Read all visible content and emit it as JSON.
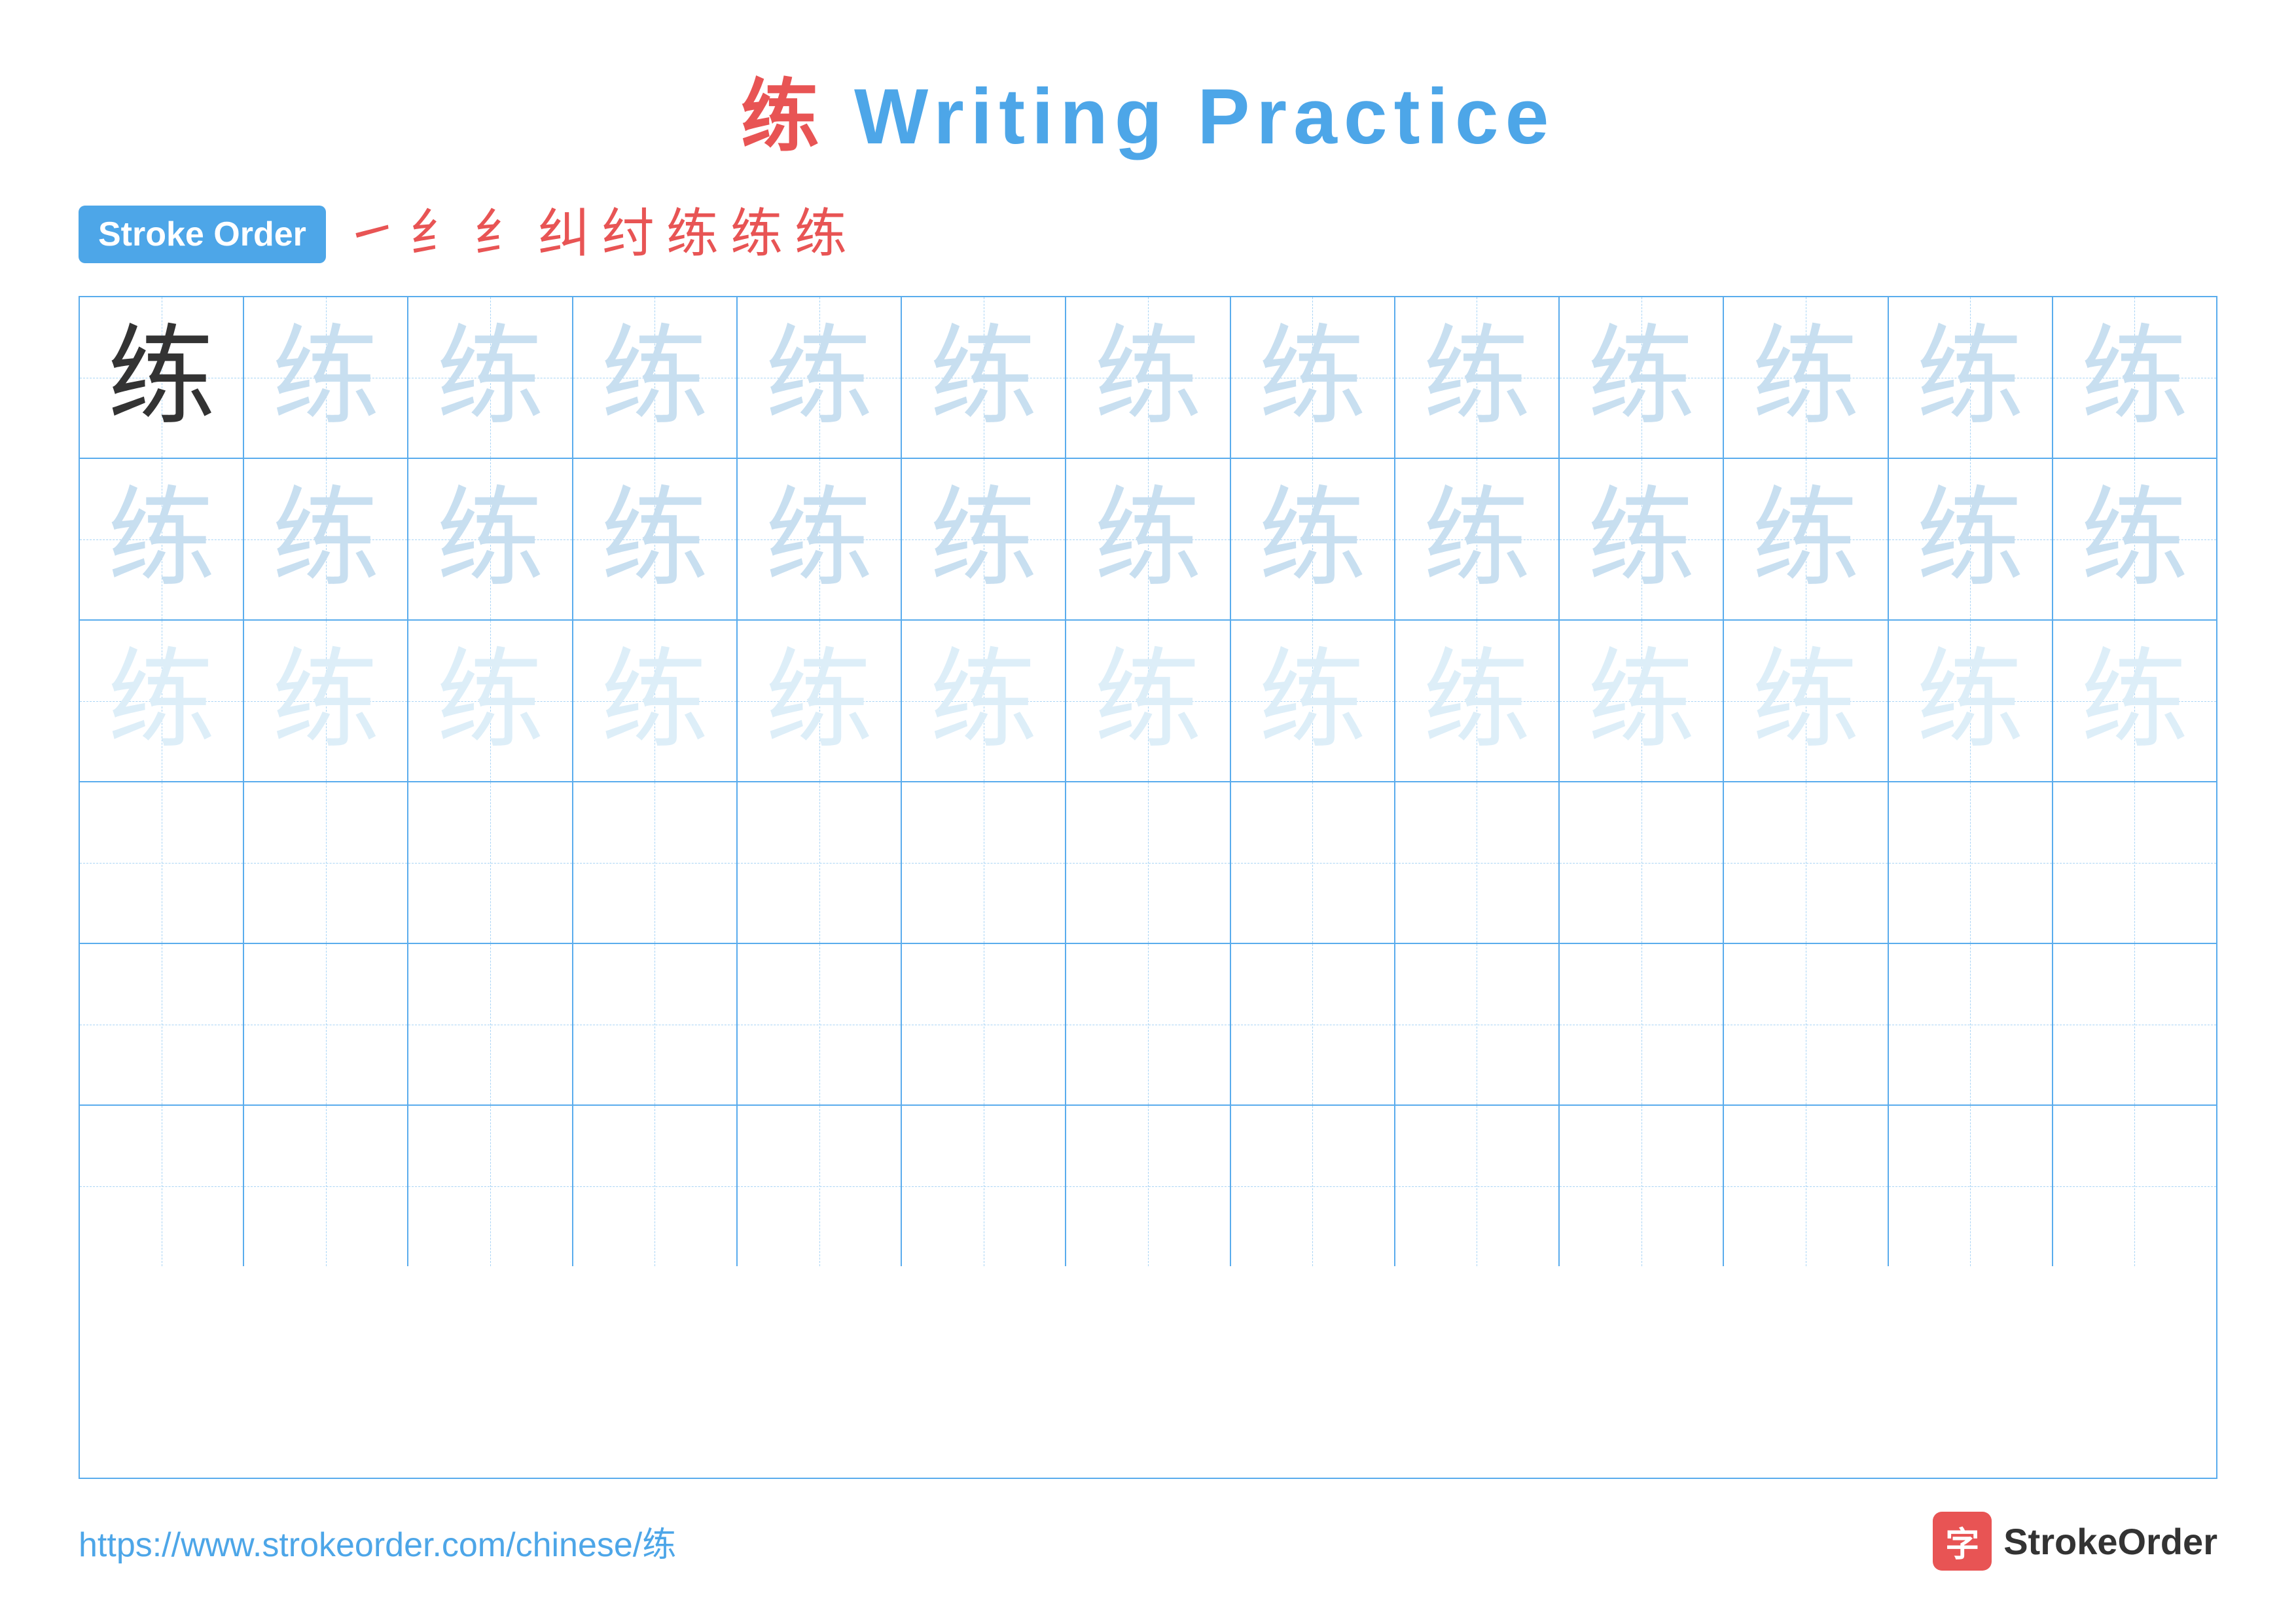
{
  "title": {
    "chinese_char": "练",
    "text": " Writing Practice"
  },
  "stroke_order": {
    "badge_label": "Stroke Order",
    "strokes": [
      "㇀",
      "纟",
      "纟",
      "纠",
      "纣",
      "练",
      "练",
      "练"
    ]
  },
  "grid": {
    "rows": 6,
    "cols": 13,
    "character": "练",
    "row_types": [
      "solid_then_light",
      "light",
      "very_light",
      "empty",
      "empty",
      "empty"
    ]
  },
  "footer": {
    "url": "https://www.strokeorder.com/chinese/练",
    "brand_char": "字",
    "brand_name": "StrokeOrder"
  }
}
